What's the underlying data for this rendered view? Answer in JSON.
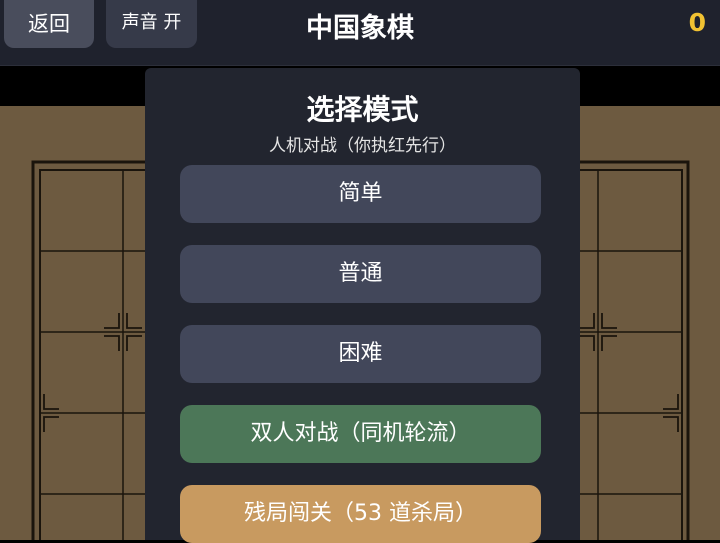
{
  "header": {
    "back_label": "返回",
    "sound_label": "声音 开",
    "title": "中国象棋",
    "score": "0"
  },
  "modal": {
    "title": "选择模式",
    "subtitle": "人机对战（你执红先行）",
    "buttons": {
      "easy": "简单",
      "normal": "普通",
      "hard": "困难",
      "pvp": "双人对战（同机轮流）",
      "puzzle": "残局闯关（53 道杀局）"
    }
  },
  "colors": {
    "topbar": "#1f222d",
    "board": "#6d5a40",
    "board_lines": "#1a140c",
    "modal": "#22252f",
    "difficulty_button": "#42475a",
    "pvp_button": "#4c7758",
    "puzzle_button": "#c89a60",
    "score": "#f1c232"
  }
}
